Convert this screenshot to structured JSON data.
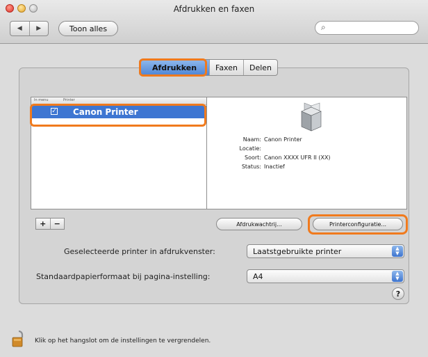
{
  "window": {
    "title": "Afdrukken en faxen"
  },
  "toolbar": {
    "back_glyph": "◀",
    "forward_glyph": "▶",
    "show_all_label": "Toon alles",
    "search_icon_glyph": "🔍",
    "search_value": ""
  },
  "tabs": [
    {
      "label": "Afdrukken",
      "active": true
    },
    {
      "label": "Faxen",
      "active": false
    },
    {
      "label": "Delen",
      "active": false
    }
  ],
  "printer_list": {
    "columns": [
      "In menu",
      "Printer"
    ],
    "rows": [
      {
        "checked": true,
        "check_glyph": "✓",
        "name": "Canon Printer",
        "selected": true
      }
    ]
  },
  "printer_info": {
    "name_key": "Naam:",
    "name_val": "Canon Printer",
    "location_key": "Locatie:",
    "location_val": "",
    "kind_key": "Soort:",
    "kind_val": "Canon XXXX UFR II (XX)",
    "status_key": "Status:",
    "status_val": "Inactief"
  },
  "list_controls": {
    "add": "+",
    "remove": "−"
  },
  "buttons": {
    "queue_label": "Afdrukwachtrij...",
    "config_label": "Printerconfiguratie..."
  },
  "settings": {
    "selected_printer_label": "Geselecteerde printer in afdrukvenster:",
    "selected_printer_value": "Laatstgebruikte printer",
    "paper_size_label": "Standaardpapierformaat bij pagina-instelling:",
    "paper_size_value": "A4"
  },
  "help_label": "?",
  "footer": {
    "lock_text": "Klik op het hangslot om de instellingen te vergrendelen."
  },
  "colors": {
    "highlight": "#f07a1d",
    "selection": "#3e76d2"
  }
}
